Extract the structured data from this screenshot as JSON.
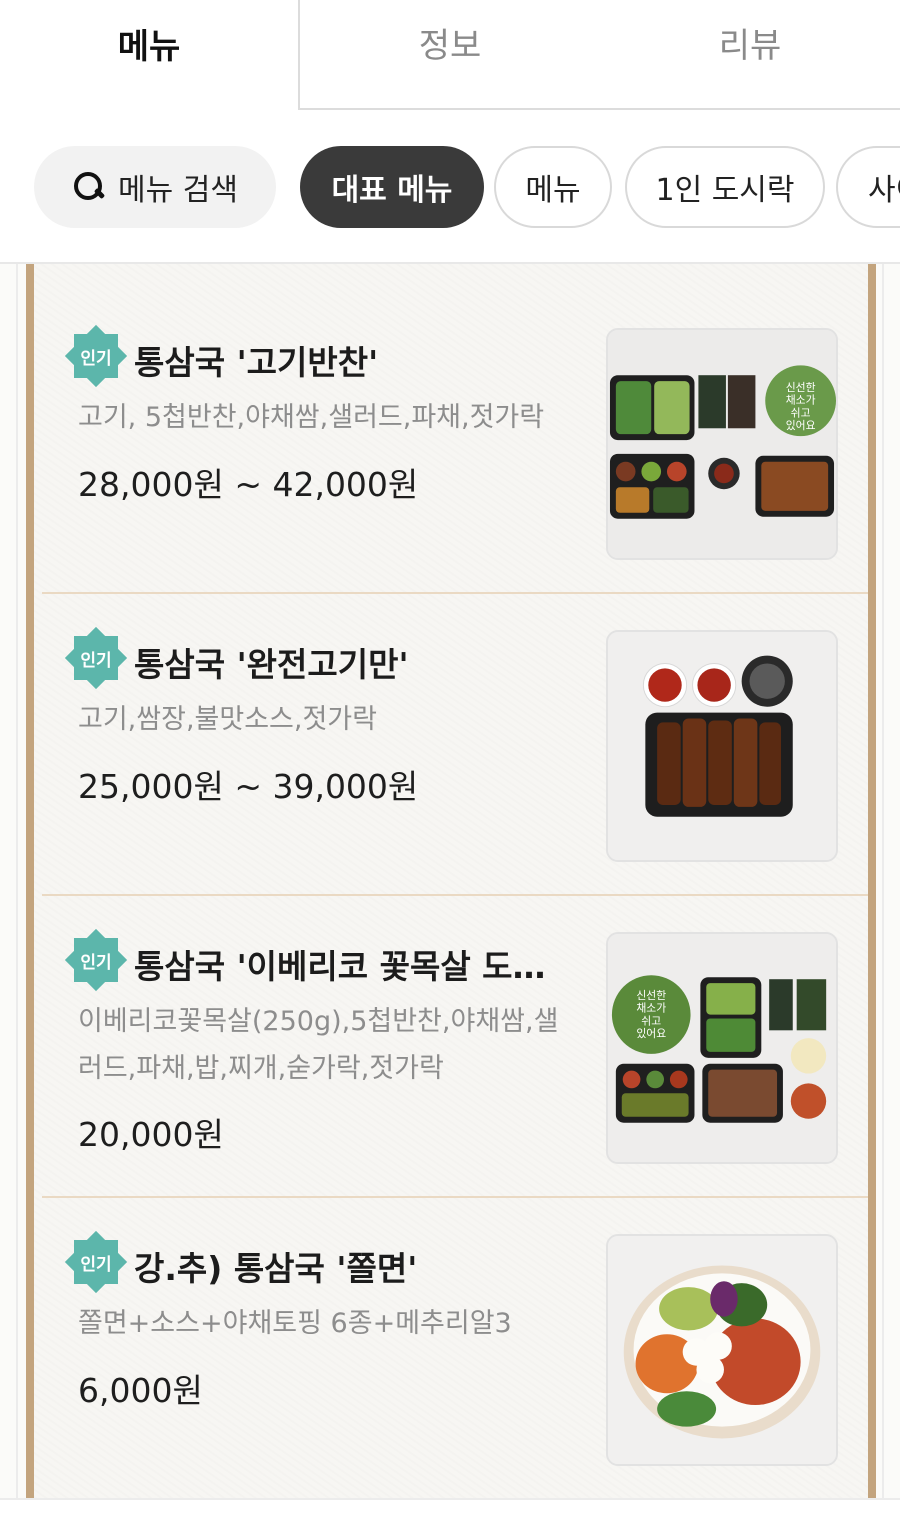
{
  "tabs": [
    {
      "label": "메뉴",
      "active": true
    },
    {
      "label": "정보",
      "active": false
    },
    {
      "label": "리뷰",
      "active": false
    }
  ],
  "chips": {
    "search_label": "메뉴 검색",
    "items": [
      "대표 메뉴",
      "메뉴",
      "1인 도시락",
      "사이"
    ]
  },
  "badge_label": "인기",
  "menu_items": [
    {
      "title": "통삼국 '고기반찬'",
      "description": "고기, 5첩반찬,야채쌈,샐러드,파채,젓가락",
      "price": "28,000원 ~ 42,000원",
      "image": "meat-lunchbox-set-photo"
    },
    {
      "title": "통삼국 '완전고기만'",
      "description": "고기,쌈장,불맛소스,젓가락",
      "price": "25,000원 ~ 39,000원",
      "image": "grilled-ribs-photo"
    },
    {
      "title": "통삼국 '이베리코 꽃목살 도…",
      "description": "이베리코꽃목살(250g),5첩반찬,야채쌈,샐러드,파채,밥,찌개,숟가락,젓가락",
      "price": "20,000원",
      "image": "iberico-lunchbox-photo"
    },
    {
      "title": "강.추) 통삼국 '쫄면'",
      "description": "쫄면+소스+야채토핑 6종+메추리알3",
      "price": "6,000원",
      "image": "jjolmyeon-bowl-photo"
    }
  ],
  "photo_labels": {
    "veg_bag": [
      "신선한",
      "채소가",
      "쉬고",
      "있어요"
    ]
  },
  "colors": {
    "badge": "#5cb6ab",
    "frame": "#c3a47e",
    "selected_chip": "#3a3a3a"
  }
}
